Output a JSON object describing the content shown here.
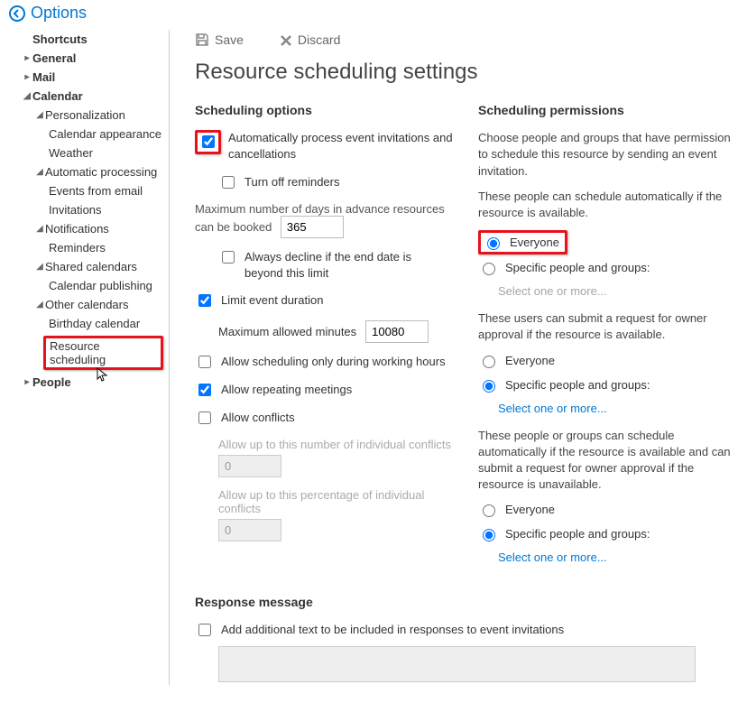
{
  "header": {
    "title": "Options"
  },
  "sidebar": {
    "shortcuts": "Shortcuts",
    "general": "General",
    "mail": "Mail",
    "calendar": "Calendar",
    "personalization": "Personalization",
    "calendar_appearance": "Calendar appearance",
    "weather": "Weather",
    "automatic_processing": "Automatic processing",
    "events_from_email": "Events from email",
    "invitations": "Invitations",
    "notifications": "Notifications",
    "reminders": "Reminders",
    "shared_calendars": "Shared calendars",
    "calendar_publishing": "Calendar publishing",
    "other_calendars": "Other calendars",
    "birthday_calendar": "Birthday calendar",
    "resource_scheduling": "Resource scheduling",
    "people": "People"
  },
  "toolbar": {
    "save": "Save",
    "discard": "Discard"
  },
  "page": {
    "title": "Resource scheduling settings"
  },
  "scheduling": {
    "head": "Scheduling options",
    "auto_process": "Automatically process event invitations and cancellations",
    "turn_off_reminders": "Turn off reminders",
    "max_days_label": "Maximum number of days in advance resources can be booked",
    "max_days_value": "365",
    "always_decline": "Always decline if the end date is beyond this limit",
    "limit_duration": "Limit event duration",
    "max_minutes_label": "Maximum allowed minutes",
    "max_minutes_value": "10080",
    "working_hours": "Allow scheduling only during working hours",
    "repeating": "Allow repeating meetings",
    "conflicts": "Allow conflicts",
    "individual_conflicts_label": "Allow up to this number of individual conflicts",
    "individual_conflicts_value": "0",
    "percentage_conflicts_label": "Allow up to this percentage of individual conflicts",
    "percentage_conflicts_value": "0"
  },
  "permissions": {
    "head": "Scheduling permissions",
    "intro": "Choose people and groups that have permission to schedule this resource by sending an event invitation.",
    "group1_label": "These people can schedule automatically if the resource is available.",
    "group2_label": "These users can submit a request for owner approval if the resource is available.",
    "group3_label": "These people or groups can schedule automatically if the resource is available and can submit a request for owner approval if the resource is unavailable.",
    "everyone": "Everyone",
    "specific": "Specific people and groups:",
    "select_one": "Select one or more..."
  },
  "response": {
    "head": "Response message",
    "add_text": "Add additional text to be included in responses to event invitations"
  }
}
